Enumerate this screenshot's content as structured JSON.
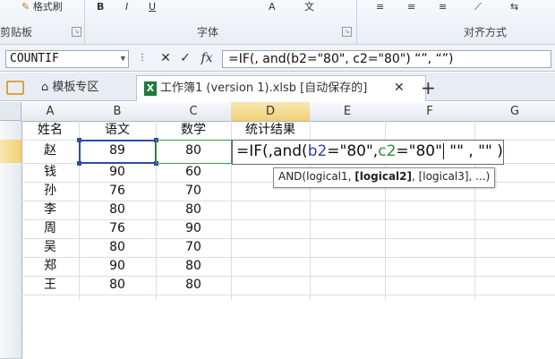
{
  "ribbon": {
    "format_painter": "格式刷",
    "clipboard_label": "剪贴板",
    "font_label": "字体",
    "align_label": "对齐方式",
    "launcher": "↘"
  },
  "formula_bar": {
    "name_box": "COUNTIF",
    "cancel": "✕",
    "enter": "✓",
    "fx": "fx",
    "formula": "=IF(, and(b2=\"80\", c2=\"80\") “”, “”)"
  },
  "tabs": {
    "template": "模板专区",
    "workbook": "工作簿1 (version 1).xlsb [自动保存的]",
    "close": "✕",
    "add": "+"
  },
  "columns": [
    "A",
    "B",
    "C",
    "D",
    "E",
    "F",
    "G"
  ],
  "headers": {
    "name": "姓名",
    "chinese": "语文",
    "math": "数学",
    "stats": "统计结果"
  },
  "rows": [
    {
      "name": "赵",
      "chinese": "89",
      "math": "80"
    },
    {
      "name": "钱",
      "chinese": "90",
      "math": "60"
    },
    {
      "name": "孙",
      "chinese": "76",
      "math": "70"
    },
    {
      "name": "李",
      "chinese": "80",
      "math": "80"
    },
    {
      "name": "周",
      "chinese": "76",
      "math": "90"
    },
    {
      "name": "吴",
      "chinese": "80",
      "math": "70"
    },
    {
      "name": "郑",
      "chinese": "90",
      "math": "80"
    },
    {
      "name": "王",
      "chinese": "80",
      "math": "80"
    }
  ],
  "edit": {
    "p1": "=IF(,and(",
    "ref_b": "b2",
    "p2": "=\"80\",",
    "ref_c": "c2",
    "p3": "=\"80\"",
    "p4": " \"\" , \"\" )"
  },
  "tooltip": {
    "fn": "AND(logical1, ",
    "bold": "[logical2]",
    "rest": ", [logical3], ...)"
  }
}
